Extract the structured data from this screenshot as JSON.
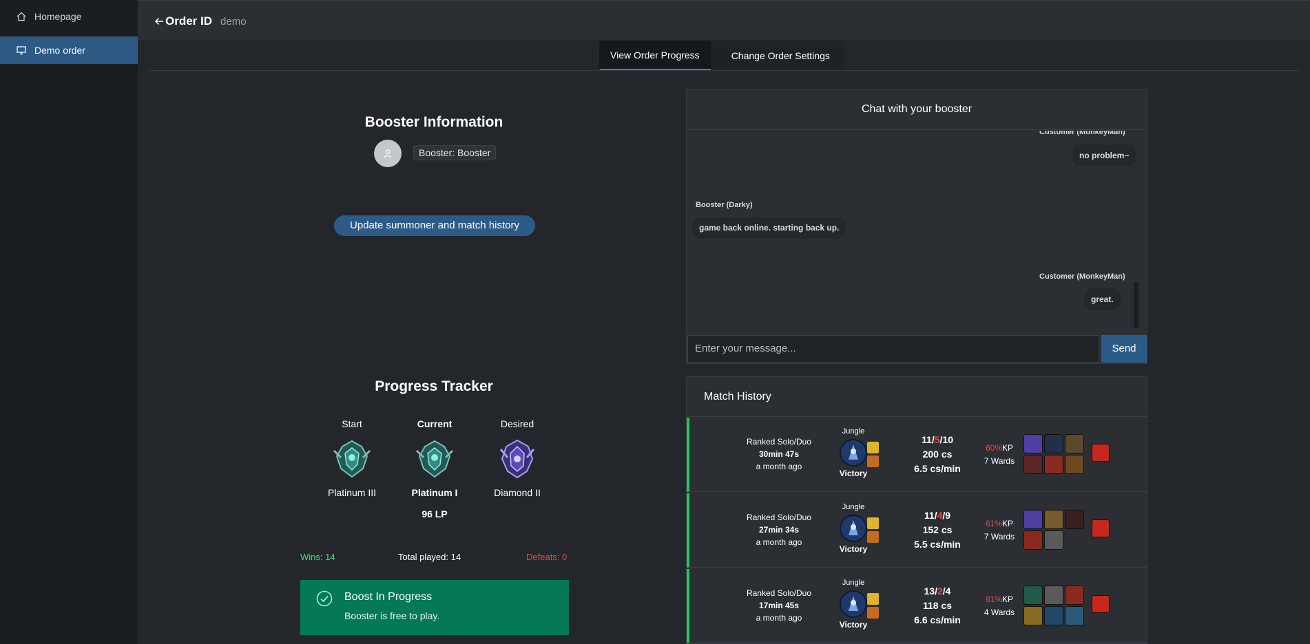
{
  "sidebar": {
    "items": [
      {
        "label": "Homepage",
        "icon": "home-icon"
      },
      {
        "label": "Demo order",
        "icon": "monitor-icon"
      }
    ]
  },
  "header": {
    "title": "Order ID",
    "subtitle": "demo"
  },
  "tabs": [
    {
      "label": "View Order Progress"
    },
    {
      "label": "Change Order Settings"
    }
  ],
  "booster": {
    "title": "Booster Information",
    "tag": "Booster: Booster",
    "update_button": "Update summoner and match history"
  },
  "progress": {
    "title": "Progress Tracker",
    "start_label": "Start",
    "current_label": "Current",
    "desired_label": "Desired",
    "start_rank": "Platinum III",
    "current_rank": "Platinum I",
    "current_lp": "96 LP",
    "desired_rank": "Diamond II",
    "wins": "Wins: 14",
    "total": "Total played: 14",
    "defeats": "Defeats: 0",
    "status_title": "Boost In Progress",
    "status_sub": "Booster is free to play."
  },
  "chat": {
    "title": "Chat with your booster",
    "messages": [
      {
        "author": "Customer (MonkeyMan)",
        "text": "no problem~"
      },
      {
        "author": "Booster (Darky)",
        "text": "game back online. starting back up."
      },
      {
        "author": "Customer (MonkeyMan)",
        "text": "great."
      }
    ],
    "input_placeholder": "Enter your message...",
    "send_label": "Send"
  },
  "match_history": {
    "title": "Match History",
    "matches": [
      {
        "queue": "Ranked Solo/Duo",
        "duration": "30min 47s",
        "when": "a month ago",
        "role": "Jungle",
        "result": "Victory",
        "kills": "11",
        "deaths": "5",
        "assists": "10",
        "cs": "200 cs",
        "cspm": "6.5 cs/min",
        "kp": "60%",
        "kp_label": "KP",
        "wards": "7 Wards"
      },
      {
        "queue": "Ranked Solo/Duo",
        "duration": "27min 34s",
        "when": "a month ago",
        "role": "Jungle",
        "result": "Victory",
        "kills": "11",
        "deaths": "4",
        "assists": "9",
        "cs": "152 cs",
        "cspm": "5.5 cs/min",
        "kp": "61%",
        "kp_label": "KP",
        "wards": "7 Wards"
      },
      {
        "queue": "Ranked Solo/Duo",
        "duration": "17min 45s",
        "when": "a month ago",
        "role": "Jungle",
        "result": "Victory",
        "kills": "13",
        "deaths": "2",
        "assists": "4",
        "cs": "118 cs",
        "cspm": "6.6 cs/min",
        "kp": "81%",
        "kp_label": "KP",
        "wards": "4 Wards"
      }
    ]
  },
  "colors": {
    "accent": "#2d5b87",
    "win": "#22c55e",
    "loss": "#ef4444",
    "status_bg": "#047857"
  }
}
